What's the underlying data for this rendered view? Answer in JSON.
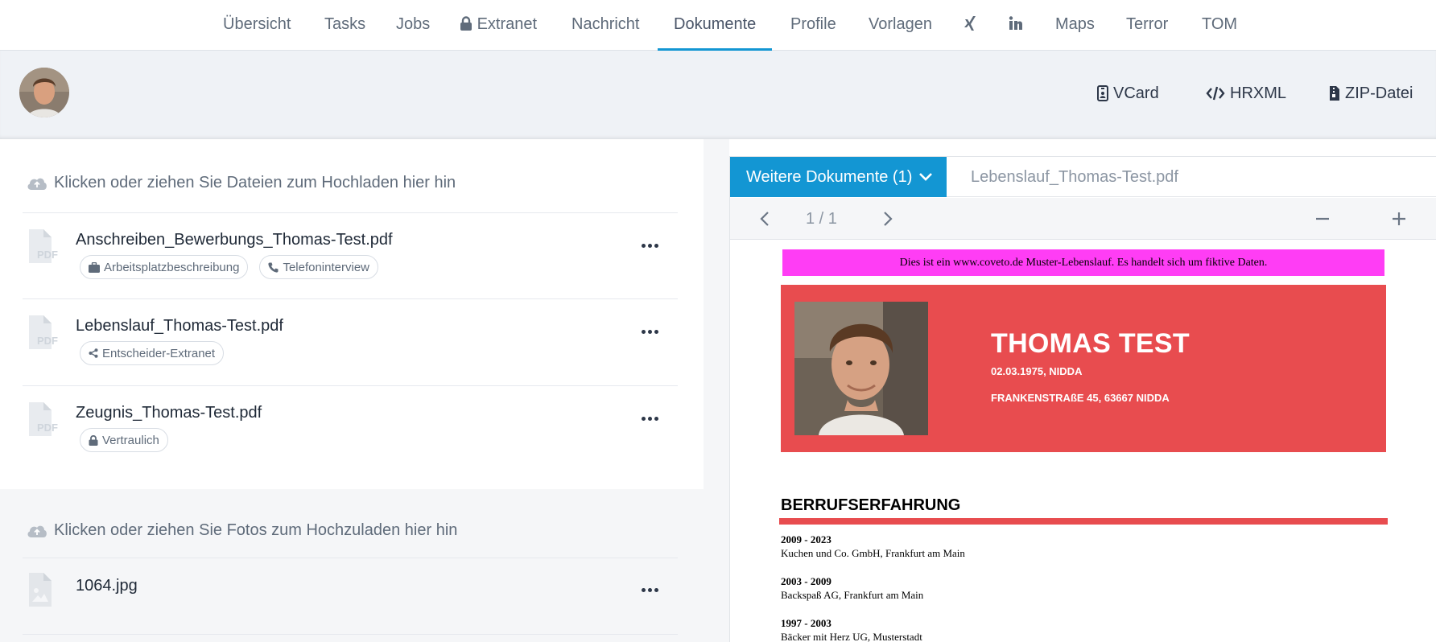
{
  "nav": {
    "items": [
      {
        "label": "Übersicht"
      },
      {
        "label": "Tasks"
      },
      {
        "label": "Jobs"
      },
      {
        "label": "Extranet",
        "icon": "lock-icon"
      },
      {
        "label": "Nachricht"
      },
      {
        "label": "Dokumente",
        "active": true
      },
      {
        "label": "Profile"
      },
      {
        "label": "Vorlagen"
      },
      {
        "label": "",
        "icon": "xing-icon"
      },
      {
        "label": "",
        "icon": "linkedin-icon"
      },
      {
        "label": "Maps"
      },
      {
        "label": "Terror"
      },
      {
        "label": "TOM"
      }
    ],
    "accent_color": "#1396d3"
  },
  "header": {
    "actions": [
      {
        "label": "VCard",
        "icon": "id-badge-icon"
      },
      {
        "label": "HRXML",
        "icon": "code-icon"
      },
      {
        "label": "ZIP-Datei",
        "icon": "file-zip-icon"
      }
    ]
  },
  "documents": {
    "upload_hint": "Klicken oder ziehen Sie Dateien zum Hochladen hier hin",
    "files": [
      {
        "name": "Anschreiben_Bewerbungs_Thomas-Test.pdf",
        "tags": [
          {
            "label": "Arbeitsplatzbeschreibung",
            "icon": "briefcase-icon"
          },
          {
            "label": "Telefoninterview",
            "icon": "phone-icon"
          }
        ]
      },
      {
        "name": "Lebenslauf_Thomas-Test.pdf",
        "tags": [
          {
            "label": "Entscheider-Extranet",
            "icon": "share-icon"
          }
        ]
      },
      {
        "name": "Zeugnis_Thomas-Test.pdf",
        "tags": [
          {
            "label": "Vertraulich",
            "icon": "lock-icon"
          }
        ]
      }
    ]
  },
  "photos": {
    "upload_hint": "Klicken oder ziehen Sie Fotos zum Hochzuladen hier hin",
    "files": [
      {
        "name": "1064.jpg"
      }
    ]
  },
  "viewer": {
    "active_tab": "Weitere Dokumente (1)",
    "inactive_tab": "Lebenslauf_Thomas-Test.pdf",
    "page_indicator": "1 / 1",
    "document": {
      "banner": "Dies ist ein www.coveto.de Muster-Lebenslauf. Es handelt sich um fiktive Daten.",
      "name": "THOMAS TEST",
      "birth": "02.03.1975, NIDDA",
      "address": "FRANKENSTRAßE 45, 63667 NIDDA",
      "section_title": "BERRUFSERFAHRUNG",
      "jobs": [
        {
          "period": "2009 - 2023",
          "company": "Kuchen und Co. GmbH, Frankfurt am Main"
        },
        {
          "period": "2003 - 2009",
          "company": "Backspaß AG, Frankfurt am Main"
        },
        {
          "period": "1997 - 2003",
          "company": "Bäcker mit Herz UG, Musterstadt"
        }
      ],
      "hero_color": "#e84c4f",
      "banner_color": "#ff3df5"
    }
  }
}
